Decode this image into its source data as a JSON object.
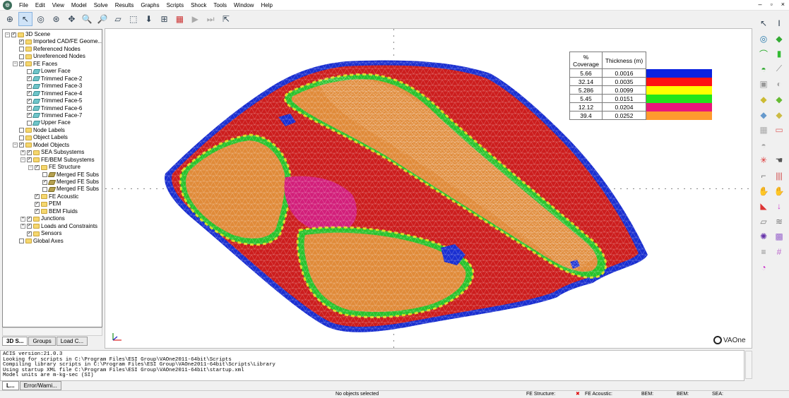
{
  "menu": {
    "items": [
      "File",
      "Edit",
      "View",
      "Model",
      "Solve",
      "Results",
      "Graphs",
      "Scripts",
      "Shock",
      "Tools",
      "Window",
      "Help"
    ]
  },
  "window_controls": [
    "–",
    "▫",
    "×"
  ],
  "tree": {
    "nodes": [
      {
        "label": "3D Scene",
        "level": 0,
        "exp": "–",
        "chk": "✓",
        "icon": "folder"
      },
      {
        "label": "Imported CAD/FE Geome...",
        "level": 1,
        "exp": "",
        "chk": "✓",
        "icon": "folder"
      },
      {
        "label": "Referenced Nodes",
        "level": 1,
        "exp": "",
        "chk": "",
        "icon": "folder"
      },
      {
        "label": "Unreferenced Nodes",
        "level": 1,
        "exp": "",
        "chk": "",
        "icon": "folder"
      },
      {
        "label": "FE Faces",
        "level": 1,
        "exp": "–",
        "chk": "✓",
        "icon": "folder"
      },
      {
        "label": "Lower Face",
        "level": 2,
        "exp": "",
        "chk": "",
        "icon": "face"
      },
      {
        "label": "Trimmed Face-2",
        "level": 2,
        "exp": "",
        "chk": "✓",
        "icon": "face"
      },
      {
        "label": "Trimmed Face-3",
        "level": 2,
        "exp": "",
        "chk": "✓",
        "icon": "face"
      },
      {
        "label": "Trimmed Face-4",
        "level": 2,
        "exp": "",
        "chk": "✓",
        "icon": "face"
      },
      {
        "label": "Trimmed Face-5",
        "level": 2,
        "exp": "",
        "chk": "✓",
        "icon": "face"
      },
      {
        "label": "Trimmed Face-6",
        "level": 2,
        "exp": "",
        "chk": "✓",
        "icon": "face"
      },
      {
        "label": "Trimmed Face-7",
        "level": 2,
        "exp": "",
        "chk": "✓",
        "icon": "face"
      },
      {
        "label": "Upper Face",
        "level": 2,
        "exp": "",
        "chk": "",
        "icon": "face"
      },
      {
        "label": "Node Labels",
        "level": 1,
        "exp": "",
        "chk": "",
        "icon": "folder"
      },
      {
        "label": "Object Labels",
        "level": 1,
        "exp": "",
        "chk": "",
        "icon": "folder"
      },
      {
        "label": "Model Objects",
        "level": 1,
        "exp": "–",
        "chk": "✓",
        "icon": "folder"
      },
      {
        "label": "SEA Subsystems",
        "level": 2,
        "exp": "+",
        "chk": "✓",
        "icon": "folder"
      },
      {
        "label": "FE/BEM Subsystems",
        "level": 2,
        "exp": "–",
        "chk": "✓",
        "icon": "folder"
      },
      {
        "label": "FE Structure",
        "level": 3,
        "exp": "–",
        "chk": "✓",
        "icon": "folder"
      },
      {
        "label": "Merged FE Subs",
        "level": 4,
        "exp": "",
        "chk": "",
        "icon": "merged"
      },
      {
        "label": "Merged FE Subs",
        "level": 4,
        "exp": "",
        "chk": "✓",
        "icon": "merged"
      },
      {
        "label": "Merged FE Subs",
        "level": 4,
        "exp": "",
        "chk": "",
        "icon": "merged"
      },
      {
        "label": "FE Acoustic",
        "level": 3,
        "exp": "",
        "chk": "✓",
        "icon": "folder"
      },
      {
        "label": "PEM",
        "level": 3,
        "exp": "",
        "chk": "✓",
        "icon": "folder"
      },
      {
        "label": "BEM Fluids",
        "level": 3,
        "exp": "",
        "chk": "✓",
        "icon": "folder"
      },
      {
        "label": "Junctions",
        "level": 2,
        "exp": "+",
        "chk": "✓",
        "icon": "folder"
      },
      {
        "label": "Loads and Constraints",
        "level": 2,
        "exp": "+",
        "chk": "✓",
        "icon": "folder"
      },
      {
        "label": "Sensors",
        "level": 2,
        "exp": "",
        "chk": "✓",
        "icon": "folder"
      },
      {
        "label": "Global Axes",
        "level": 1,
        "exp": "",
        "chk": "",
        "icon": "folder"
      }
    ]
  },
  "panel_tabs": [
    "3D S...",
    "Groups",
    "Load C..."
  ],
  "legend": {
    "header": [
      "% Coverage",
      "Thickness (m)"
    ],
    "rows": [
      {
        "coverage": "5.66",
        "thickness": "0.0016",
        "color": "#0a22e0"
      },
      {
        "coverage": "32.14",
        "thickness": "0.0035",
        "color": "#ff1212"
      },
      {
        "coverage": "5.286",
        "thickness": "0.0099",
        "color": "#ffff00"
      },
      {
        "coverage": "5.45",
        "thickness": "0.0151",
        "color": "#22e51a"
      },
      {
        "coverage": "12.12",
        "thickness": "0.0204",
        "color": "#e8187a"
      },
      {
        "coverage": "39.4",
        "thickness": "0.0252",
        "color": "#ff9a2e"
      }
    ]
  },
  "mesh_colors": {
    "edge": "#1a2fd0",
    "outer": "#cc1d1d",
    "orange": "#e08b3a",
    "magenta": "#d21f7a",
    "yellow": "#d9d91c",
    "green": "#28c22c"
  },
  "brand": "VAOne",
  "console": {
    "lines": [
      "ACIS version:21.0.3",
      "Looking for scripts in C:\\Program Files\\ESI Group\\VAOne2011-64bit\\Scripts",
      "Compiling library scripts in C:\\Program Files\\ESI Group\\VAOne2011-64bit\\Scripts\\Library",
      "Using startup XML file C:\\Program Files\\ESI Group\\VAOne2011-64bit\\startup.xml",
      "Model units are m-kg-sec (SI)"
    ],
    "tabs": [
      "L...",
      "Error/Warni..."
    ]
  },
  "status": {
    "selection": "No objects selected",
    "fe_structure": "FE Structure:",
    "fe_acoustic": "FE Acoustic:",
    "bem1": "BEM:",
    "bem2": "BEM:",
    "sea": "SEA:"
  }
}
